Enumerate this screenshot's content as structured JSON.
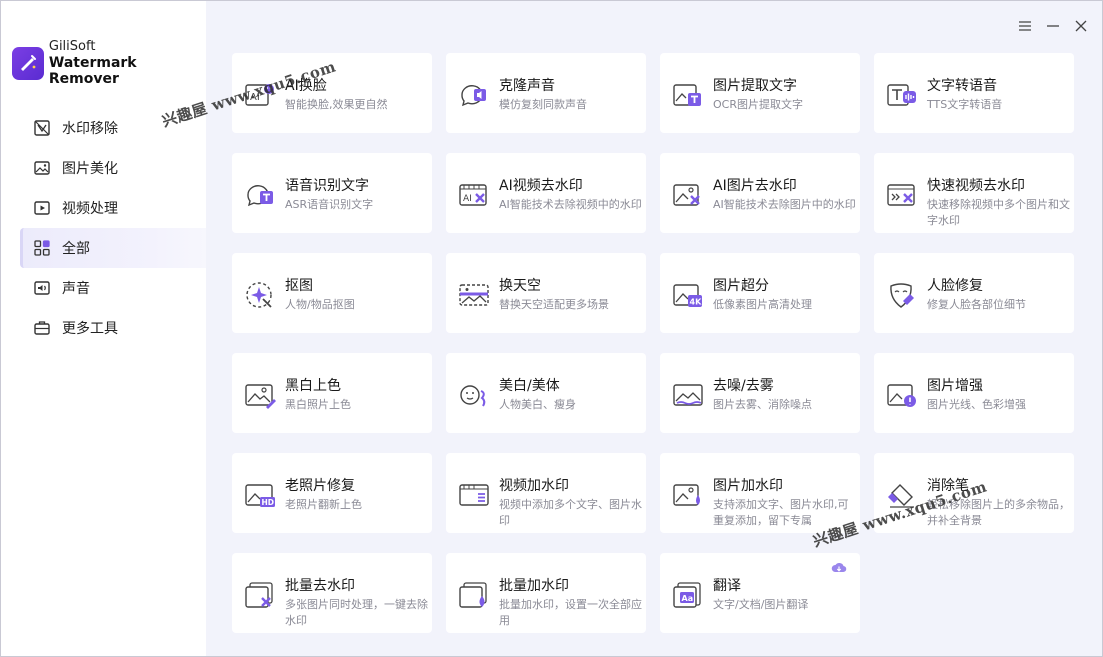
{
  "brand": {
    "name": "GiliSoft",
    "product": "Watermark Remover"
  },
  "sidebar": {
    "items": [
      {
        "label": "水印移除",
        "icon": "watermark-remove-icon"
      },
      {
        "label": "图片美化",
        "icon": "image-beautify-icon"
      },
      {
        "label": "视频处理",
        "icon": "video-process-icon"
      },
      {
        "label": "全部",
        "icon": "all-apps-icon",
        "active": true
      },
      {
        "label": "声音",
        "icon": "sound-icon"
      },
      {
        "label": "更多工具",
        "icon": "toolbox-icon"
      }
    ]
  },
  "window_controls": [
    "menu-icon",
    "minimize-icon",
    "close-icon"
  ],
  "cards": [
    {
      "title": "AI换脸",
      "desc": "智能换脸,效果更自然",
      "icon": "ai-face-swap-icon"
    },
    {
      "title": "克隆声音",
      "desc": "模仿复刻同款声音",
      "icon": "voice-clone-icon"
    },
    {
      "title": "图片提取文字",
      "desc": "OCR图片提取文字",
      "icon": "image-ocr-icon"
    },
    {
      "title": "文字转语音",
      "desc": "TTS文字转语音",
      "icon": "text-to-speech-icon"
    },
    {
      "title": "语音识别文字",
      "desc": "ASR语音识别文字",
      "icon": "speech-to-text-icon"
    },
    {
      "title": "AI视频去水印",
      "desc": "AI智能技术去除视频中的水印",
      "icon": "ai-video-watermark-icon"
    },
    {
      "title": "AI图片去水印",
      "desc": "AI智能技术去除图片中的水印",
      "icon": "ai-image-watermark-icon"
    },
    {
      "title": "快速视频去水印",
      "desc": "快速移除视频中多个图片和文字水印",
      "icon": "fast-video-watermark-icon"
    },
    {
      "title": "抠图",
      "desc": "人物/物品抠图",
      "icon": "cutout-icon"
    },
    {
      "title": "换天空",
      "desc": "替换天空适配更多场景",
      "icon": "sky-replace-icon"
    },
    {
      "title": "图片超分",
      "desc": "低像素图片高清处理",
      "icon": "image-upscale-icon"
    },
    {
      "title": "人脸修复",
      "desc": "修复人脸各部位细节",
      "icon": "face-repair-icon"
    },
    {
      "title": "黑白上色",
      "desc": "黑白照片上色",
      "icon": "colorize-icon"
    },
    {
      "title": "美白/美体",
      "desc": "人物美白、瘦身",
      "icon": "beauty-body-icon"
    },
    {
      "title": "去噪/去雾",
      "desc": "图片去雾、消除噪点",
      "icon": "denoise-icon"
    },
    {
      "title": "图片增强",
      "desc": "图片光线、色彩增强",
      "icon": "image-enhance-icon"
    },
    {
      "title": "老照片修复",
      "desc": "老照片翻新上色",
      "icon": "old-photo-hd-icon"
    },
    {
      "title": "视频加水印",
      "desc": "视频中添加多个文字、图片水印",
      "icon": "video-add-watermark-icon"
    },
    {
      "title": "图片加水印",
      "desc": "支持添加文字、图片水印,可重复添加，留下专属",
      "icon": "image-add-watermark-icon"
    },
    {
      "title": "消除笔",
      "desc": "轻松移除图片上的多余物品，并补全背景",
      "icon": "eraser-pen-icon"
    },
    {
      "title": "批量去水印",
      "desc": "多张图片同时处理，一键去除水印",
      "icon": "batch-remove-watermark-icon"
    },
    {
      "title": "批量加水印",
      "desc": "批量加水印，设置一次全部应用",
      "icon": "batch-add-watermark-icon"
    },
    {
      "title": "翻译",
      "desc": "文字/文档/图片翻译",
      "icon": "translate-icon",
      "badge": "cloud-download-icon"
    }
  ],
  "overlay_watermarks": [
    {
      "text": "兴趣屋 www.xqu5.com"
    },
    {
      "text": "兴趣屋 www.xqu5.com"
    }
  ],
  "colors": {
    "accent": "#6a4ee0",
    "sidebar_active": "#ecebfb",
    "main_bg": "#f2f3fb"
  }
}
